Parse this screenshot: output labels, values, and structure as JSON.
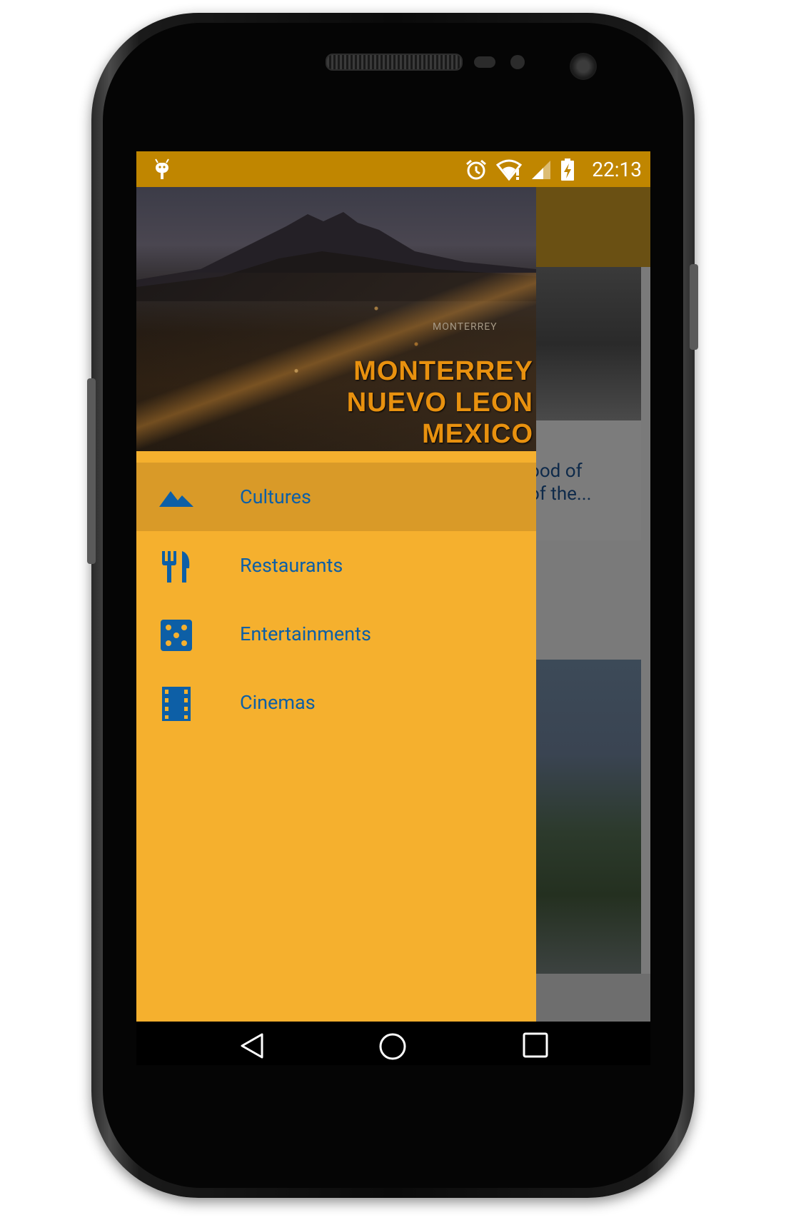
{
  "status_bar": {
    "time": "22:13",
    "icons": [
      "android-debug-icon",
      "alarm-icon",
      "wifi-icon",
      "signal-icon",
      "battery-charging-icon"
    ]
  },
  "drawer": {
    "header": {
      "caption_line1": "MONTERREY",
      "caption_line2": "NUEVO LEON",
      "caption_line3": "MEXICO",
      "watermark": "MONTERREY"
    },
    "items": [
      {
        "label": "Cultures",
        "icon": "landscape-icon",
        "selected": true
      },
      {
        "label": "Restaurants",
        "icon": "restaurant-icon",
        "selected": false
      },
      {
        "label": "Entertainments",
        "icon": "dice-icon",
        "selected": false
      },
      {
        "label": "Cinemas",
        "icon": "film-icon",
        "selected": false
      }
    ]
  },
  "background_content": {
    "card_text_line1": "ood of",
    "card_text_line2": "of the..."
  },
  "navigation_bar": {
    "buttons": [
      "back",
      "home",
      "recents"
    ]
  },
  "colors": {
    "status_bar": "#c08600",
    "drawer_bg": "#f5b02e",
    "selected_item": "#d99a28",
    "menu_text": "#0d5fa6"
  }
}
